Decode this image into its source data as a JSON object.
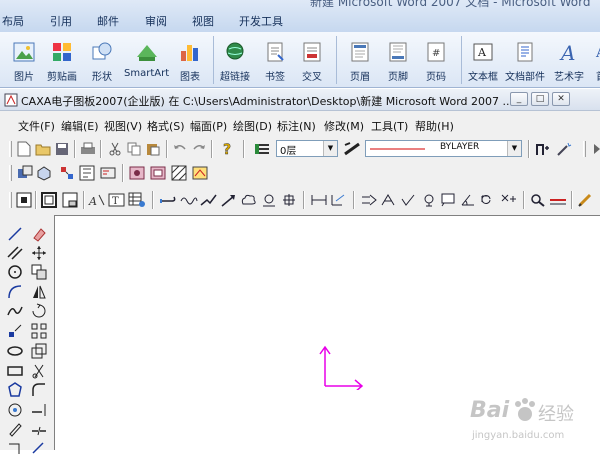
{
  "word_window": {
    "title": "新建 Microsoft Word 2007 文档 - Microsoft Word",
    "tabs": [
      "布局",
      "引用",
      "邮件",
      "审阅",
      "视图",
      "开发工具"
    ],
    "ribbon_buttons": [
      "图片",
      "剪贴画",
      "形状",
      "SmartArt",
      "图表",
      "超链接",
      "书签",
      "交叉",
      "页眉",
      "页脚",
      "页码",
      "文本框",
      "文档部件",
      "艺术字",
      "首"
    ]
  },
  "caxa_window": {
    "title": "CAXA电子图板2007(企业版) 在 C:\\Users\\Administrator\\Desktop\\新建 Microsoft Word 2007 ...",
    "menu": [
      "文件(F)",
      "编辑(E)",
      "视图(V)",
      "格式(S)",
      "幅面(P)",
      "绘图(D)",
      "标注(N)",
      "修改(M)",
      "工具(T)",
      "帮助(H)"
    ],
    "layer_value": "0层",
    "linetype_value": "BYLAYER",
    "win_buttons": [
      "_",
      "□",
      "✕"
    ]
  },
  "watermark": {
    "brand": "Bai",
    "brand2": "经验",
    "url": "jingyan.baidu.com"
  },
  "colors": {
    "ucs_arrow": "#e800e8",
    "line_color": "#d40000"
  }
}
